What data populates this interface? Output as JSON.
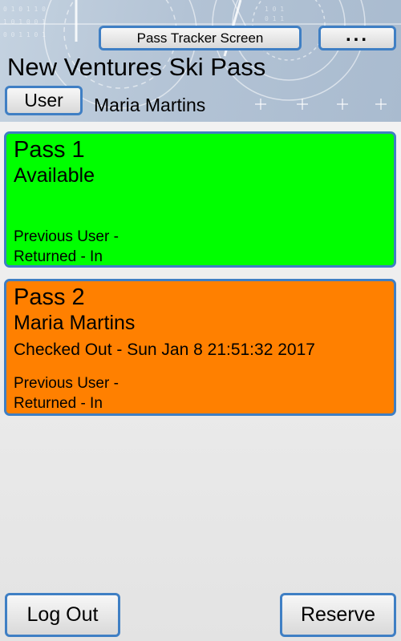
{
  "header": {
    "screen_button_label": "Pass Tracker Screen",
    "more_button_label": "...",
    "title": "New Ventures Ski Pass",
    "user_button_label": "User",
    "user_name": "Maria Martins"
  },
  "passes": [
    {
      "name": "Pass 1",
      "status": "Available",
      "checkout_line": "",
      "previous_user": "Previous User -",
      "returned": "Returned - In",
      "color": "#00ff00"
    },
    {
      "name": "Pass 2",
      "status": "Maria Martins",
      "checkout_line": "Checked Out - Sun Jan 8 21:51:32 2017",
      "previous_user": "Previous User -",
      "returned": "Returned - In",
      "color": "#ff8000"
    }
  ],
  "footer": {
    "logout_label": "Log Out",
    "reserve_label": "Reserve"
  },
  "colors": {
    "accent_border": "#3f7fc4"
  }
}
